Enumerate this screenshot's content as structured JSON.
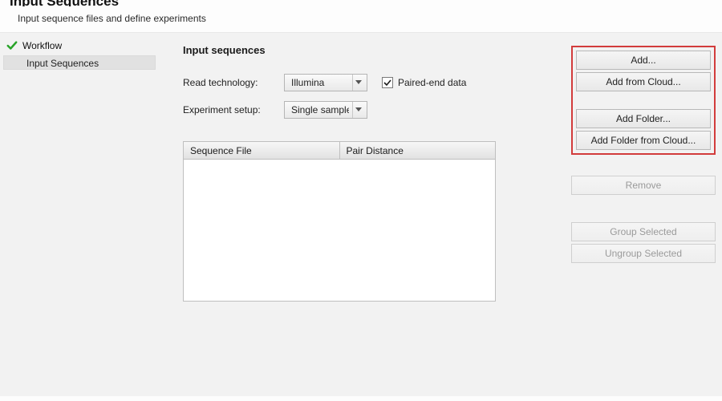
{
  "header": {
    "title": "Input Sequences",
    "subtitle": "Input sequence files and define experiments"
  },
  "nav": {
    "workflow": "Workflow",
    "current": "Input Sequences"
  },
  "main": {
    "section_title": "Input sequences",
    "read_tech_label": "Read technology:",
    "read_tech_value": "Illumina",
    "paired_end_label": "Paired-end data",
    "paired_end_checked": true,
    "experiment_label": "Experiment setup:",
    "experiment_value": "Single sample",
    "table": {
      "col1": "Sequence File",
      "col2": "Pair Distance"
    }
  },
  "actions": {
    "add": "Add...",
    "add_cloud": "Add from Cloud...",
    "add_folder": "Add Folder...",
    "add_folder_cloud": "Add Folder from Cloud...",
    "remove": "Remove",
    "group": "Group Selected",
    "ungroup": "Ungroup Selected"
  }
}
